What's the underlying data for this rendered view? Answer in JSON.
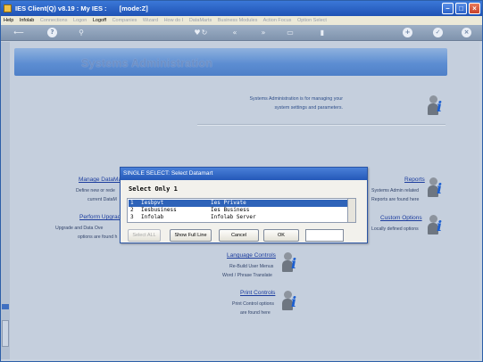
{
  "window": {
    "app_title": "IES Client(Q) v8.19 : My IES :",
    "mode": "[mode:Z]"
  },
  "menu": {
    "items": [
      {
        "label": "Help",
        "enabled": true
      },
      {
        "label": "Infolab",
        "enabled": true
      },
      {
        "label": "Connections",
        "enabled": false
      },
      {
        "label": "Logon",
        "enabled": false
      },
      {
        "label": "Logoff",
        "enabled": true
      },
      {
        "label": "Companies",
        "enabled": false
      },
      {
        "label": "Wizard",
        "enabled": false
      },
      {
        "label": "How do I",
        "enabled": false
      },
      {
        "label": "DataMarts",
        "enabled": false
      },
      {
        "label": "Business Modules",
        "enabled": false
      },
      {
        "label": "Action Focus",
        "enabled": false
      },
      {
        "label": "Option Select",
        "enabled": false
      }
    ]
  },
  "toolbar": {
    "icons": [
      "back-arrow-icon",
      "help-icon",
      "search-icon",
      "favorite-icon",
      "refresh-icon",
      "rewind-icon",
      "forward-icon",
      "print-icon",
      "bookmark-icon",
      "add-icon",
      "check-icon",
      "close-icon"
    ],
    "help_glyph": "?",
    "plus_glyph": "+",
    "check_glyph": "✓",
    "close_glyph": "×",
    "back_glyph": "⟵",
    "search_glyph": "⚲",
    "heart_glyph": "♥",
    "refresh_glyph": "↻",
    "rewind_glyph": "«",
    "forward_glyph": "»",
    "print_glyph": "▭",
    "bookmark_glyph": "▮"
  },
  "page": {
    "title": "Systems Administration",
    "intro": [
      "Systems Administration is for managing your",
      "system settings and parameters."
    ],
    "info_glyph": "i"
  },
  "sections": {
    "manage_datamarts": {
      "link": "Manage DataMa",
      "desc": [
        "Define new or rede",
        "current DataM"
      ]
    },
    "perform_upgrades": {
      "link": "Perform Upgrad",
      "desc": [
        "Upgrade and Data Ove",
        "options are found h"
      ]
    },
    "reports": {
      "link": "Reports",
      "desc": [
        "Systems Admin related",
        "Reports are found here"
      ]
    },
    "custom_options": {
      "link": "Custom Options",
      "desc": [
        "Locally defined options"
      ]
    },
    "language_controls": {
      "link": "Language Controls",
      "desc": [
        "Re-Build User Menus",
        "Word / Phrase Translate"
      ]
    },
    "print_controls": {
      "link": "Print Controls",
      "desc": [
        "Print Control options",
        "are found here"
      ]
    }
  },
  "dialog": {
    "title": "SINGLE SELECT: Select Datamart",
    "subtitle": "Select Only 1",
    "rows": [
      {
        "num": "1",
        "code": "Iesbpvt",
        "name": "Ies Private",
        "selected": true
      },
      {
        "num": "2",
        "code": "Iesbusiness",
        "name": "Ies Business",
        "selected": false
      },
      {
        "num": "3",
        "code": "Infolab",
        "name": "Infolab Server",
        "selected": false
      }
    ],
    "buttons": {
      "select_all": "Select ALL",
      "show_full_line": "Show Full Line",
      "cancel": "Cancel",
      "ok": "OK"
    },
    "input_value": ""
  },
  "colors": {
    "titlebar": "#1f52b4",
    "banner": "#5d8ed2",
    "background": "#c5cfdd",
    "selection": "#2e63b9",
    "link": "#1b3c9e",
    "info_icon": "#1c5fd1"
  }
}
